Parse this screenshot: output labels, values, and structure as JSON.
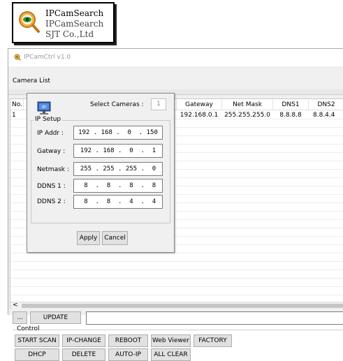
{
  "app_card": {
    "name_line1": "IPCamSearch",
    "name_line2": "IPCamSearch",
    "name_line3": "SJT Co.,Ltd"
  },
  "window": {
    "title": "IPCamCtrl v1.0",
    "camera_list_label": "Camera List"
  },
  "list": {
    "columns": [
      "No.",
      "Gateway",
      "Net Mask",
      "DNS1",
      "DNS2"
    ],
    "rows": [
      {
        "no": "1",
        "gateway": "192.168.0.1",
        "netmask": "255.255.255.0",
        "dns1": "8.8.8.8",
        "dns2": "8.8.4.4"
      }
    ],
    "scroll_left_arrow": "<"
  },
  "dialog": {
    "select_cameras_label": "Select Cameras :",
    "select_cameras_value": "1",
    "group_label": "IP Setup",
    "fields": {
      "ip_addr_label": "IP Addr :",
      "ip_addr_value": "192 . 168 .  0  . 150",
      "gateway_label": "Gatway :",
      "gateway_value": "192 . 168 .  0  .  1",
      "netmask_label": "Netmask :",
      "netmask_value": "255 . 255 . 255 .  0",
      "ddns1_label": "DDNS 1 :",
      "ddns1_value": " 8  .  8  .  8  .  8",
      "ddns2_label": "DDNS 2 :",
      "ddns2_value": " 8  .  8  .  4  .  4"
    },
    "apply_label": "Apply",
    "cancel_label": "Cancel"
  },
  "bottom": {
    "browse_label": "...",
    "update_label": "UPDATE",
    "path_value": "",
    "control_label": "Control",
    "buttons_row1": [
      "START SCAN",
      "IP-CHANGE",
      "REBOOT",
      "Web Viewer",
      "FACTORY"
    ],
    "buttons_row2": [
      "DHCP",
      "DELETE",
      "AUTO-IP",
      "ALL CLEAR"
    ]
  },
  "colors": {
    "window_bg": "#f0f0f0",
    "button_bg": "#e1e1e1",
    "icon_blue": "#2d5fb0",
    "magnifier_orange": "#f0a030"
  }
}
